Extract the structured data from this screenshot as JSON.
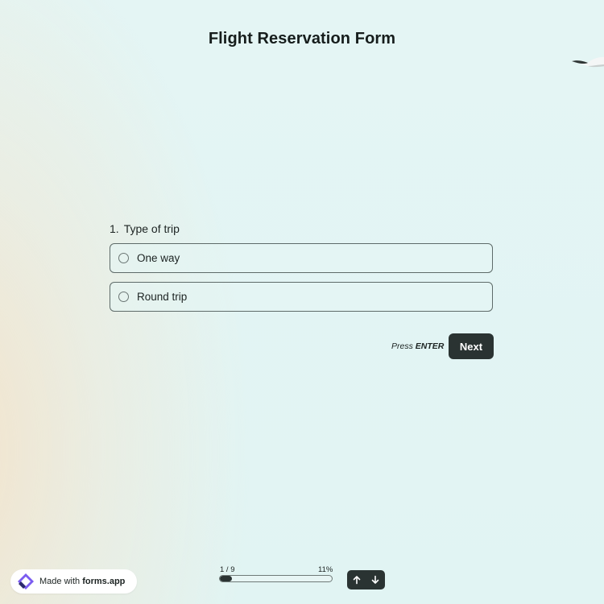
{
  "form": {
    "title": "Flight Reservation Form"
  },
  "question": {
    "number": "1.",
    "text": "Type of trip",
    "options": [
      {
        "label": "One way",
        "selected": false
      },
      {
        "label": "Round trip",
        "selected": false
      }
    ]
  },
  "actions": {
    "press_prefix": "Press",
    "press_key": "ENTER",
    "next_label": "Next"
  },
  "footer": {
    "badge_prefix": "Made with",
    "badge_brand": "forms.app",
    "progress_count": "1 / 9",
    "progress_percent": "11%",
    "progress_value": 0.11,
    "nav_up_icon": "arrow-up-icon",
    "nav_down_icon": "arrow-down-icon"
  },
  "colors": {
    "primary": "#2a3332",
    "background": "#e1f4f3",
    "border": "#5e6b69"
  }
}
